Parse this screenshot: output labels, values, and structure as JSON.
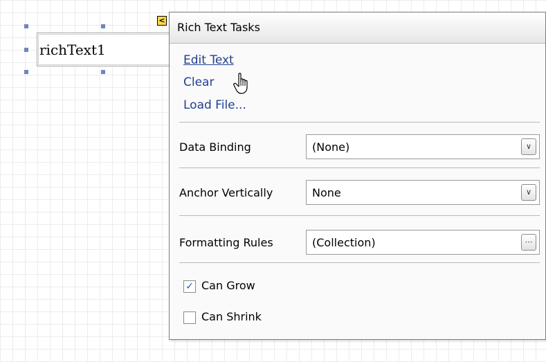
{
  "control": {
    "text": "richText1"
  },
  "smart_tag": {
    "glyph": "<"
  },
  "panel": {
    "title": "Rich Text Tasks",
    "links": [
      "Edit Text",
      "Clear",
      "Load File..."
    ],
    "properties": [
      {
        "label": "Data Binding",
        "value": "(None)",
        "button": "dropdown"
      },
      {
        "label": "Anchor Vertically",
        "value": "None",
        "button": "dropdown"
      },
      {
        "label": "Formatting Rules",
        "value": "(Collection)",
        "button": "ellipsis"
      }
    ],
    "checkboxes": [
      {
        "label": "Can Grow",
        "checked": true
      },
      {
        "label": "Can Shrink",
        "checked": false
      }
    ]
  },
  "icons": {
    "dropdown": "chevron-down-icon",
    "ellipsis": "ellipsis-icon",
    "check": "check-icon",
    "cursor": "hand-pointer-icon"
  },
  "colors": {
    "link": "#1f3f8f",
    "handle": "#6f86b6",
    "smart_tag": "#ffd84a"
  }
}
